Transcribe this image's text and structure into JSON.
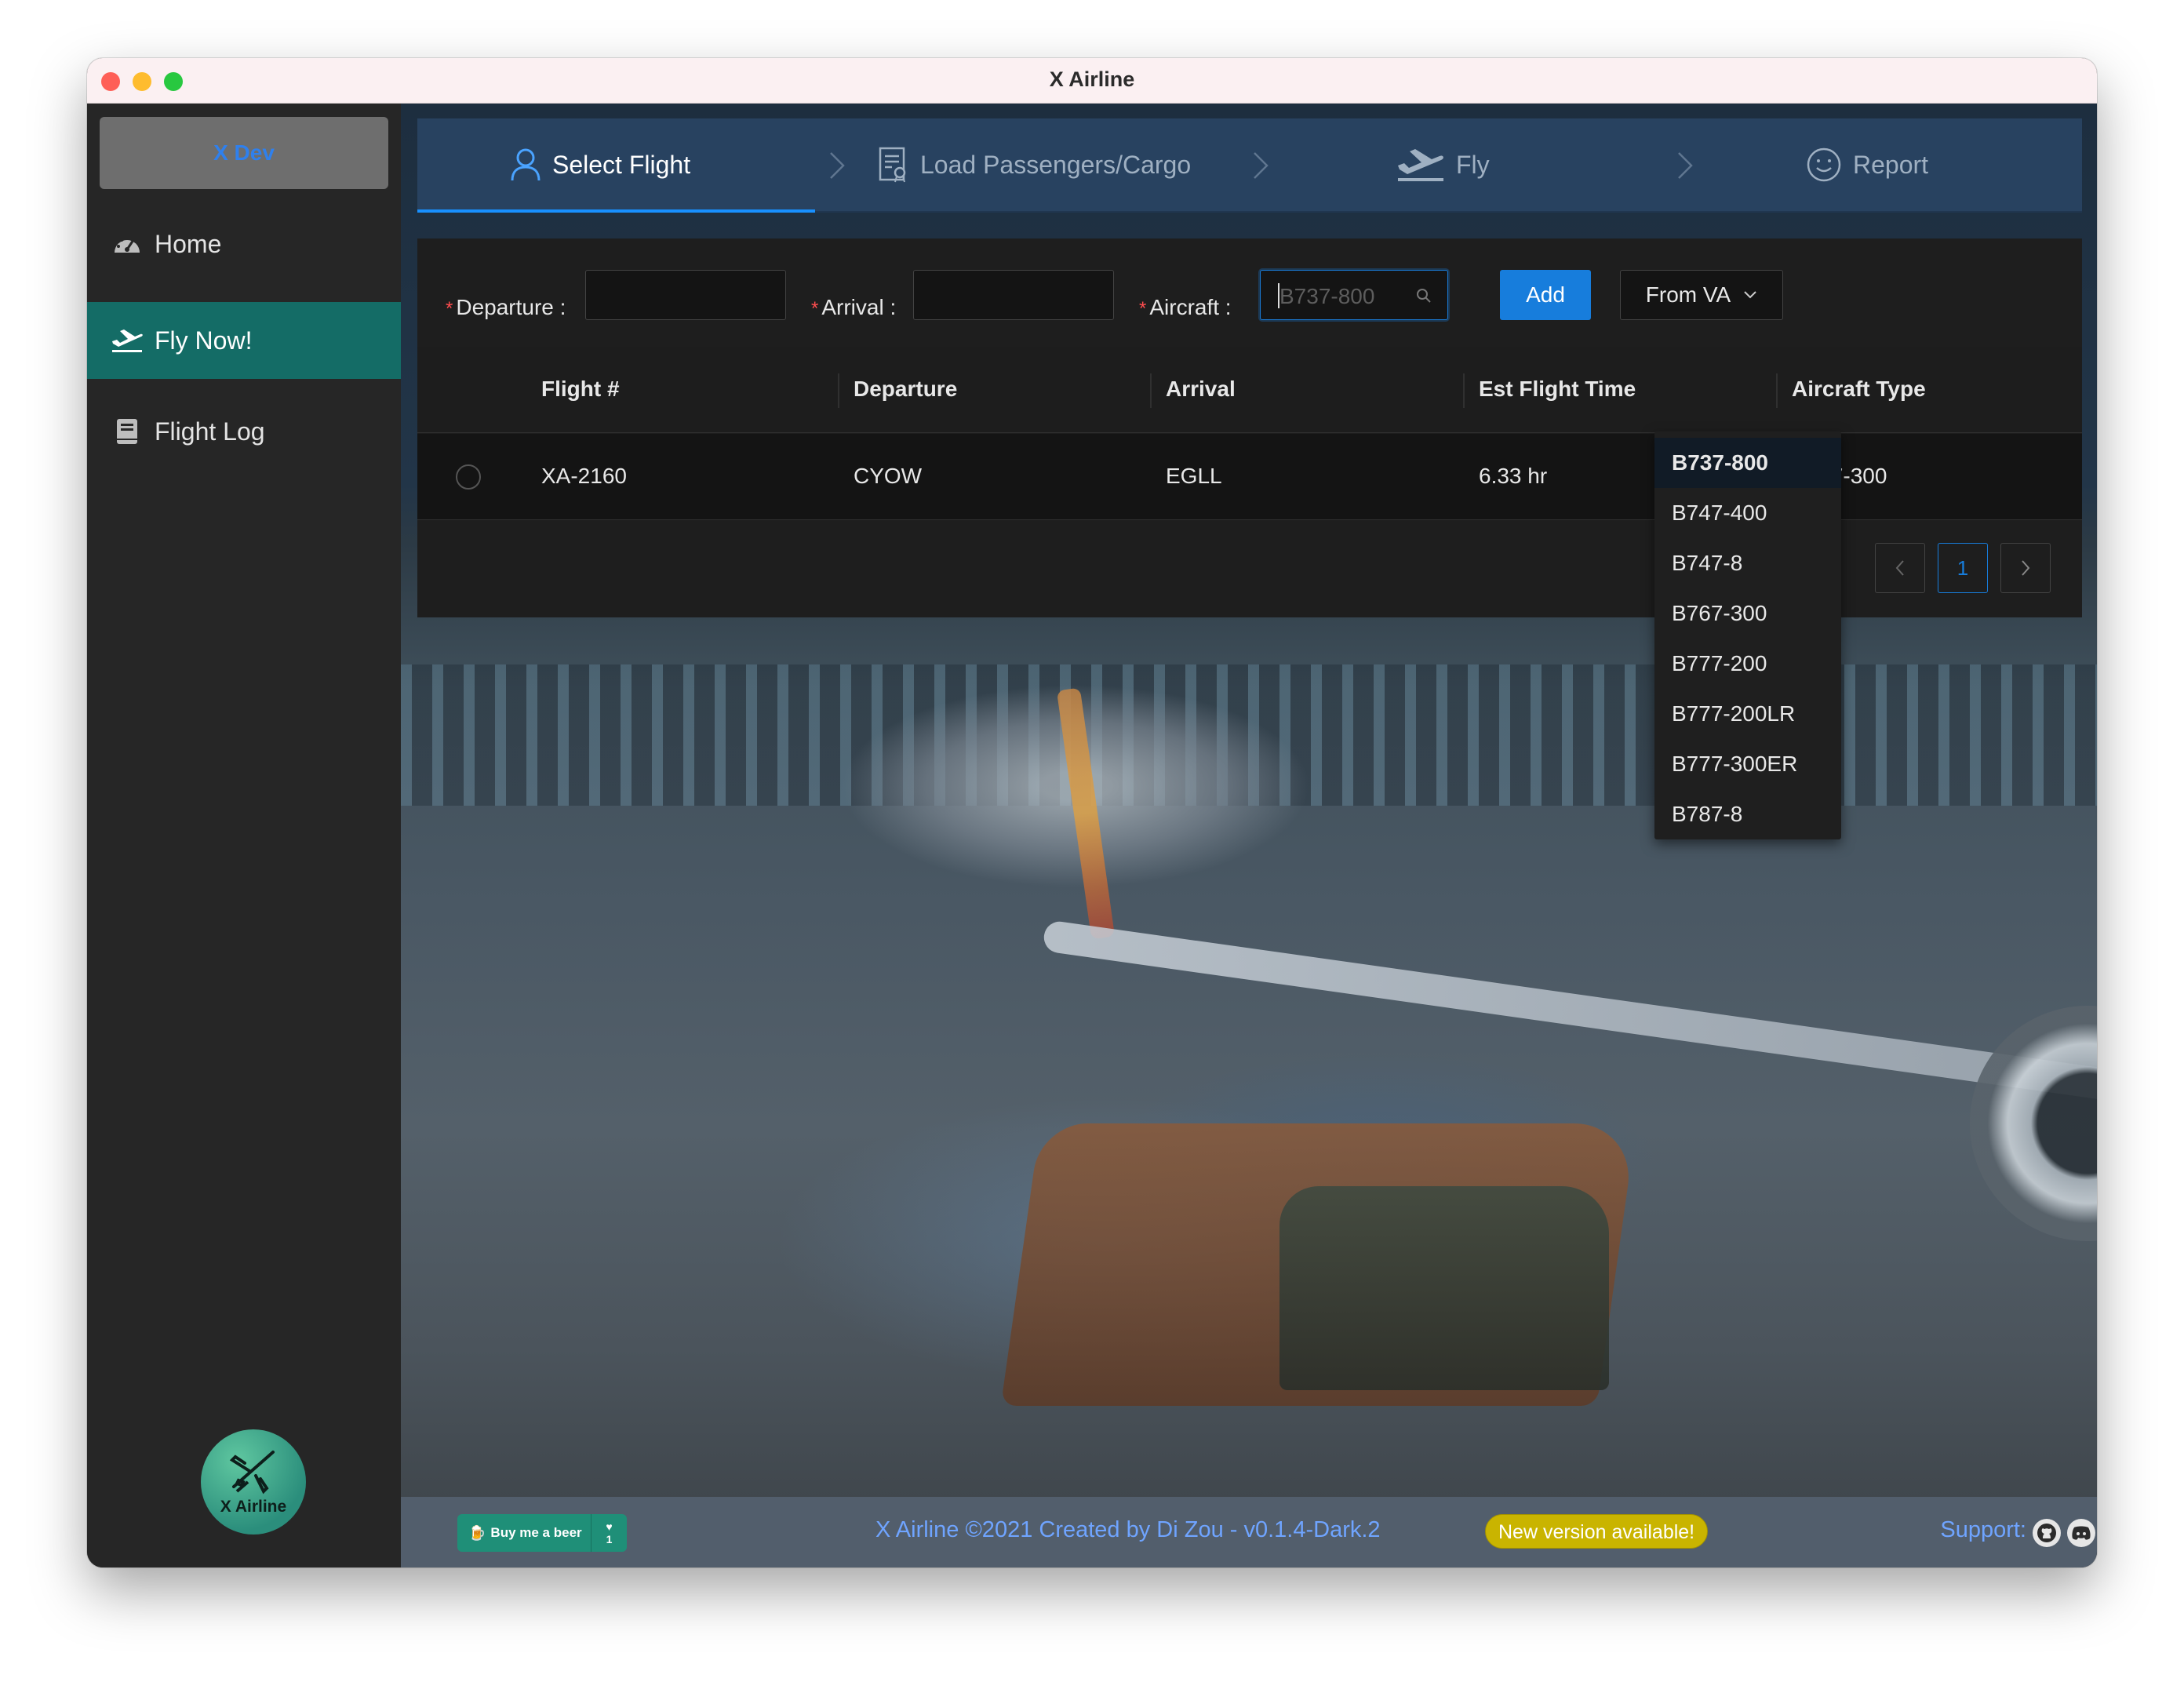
{
  "window": {
    "title": "X Airline"
  },
  "sidebar": {
    "user": "X Dev",
    "items": [
      {
        "label": "Home",
        "icon": "dashboard-icon"
      },
      {
        "label": "Fly Now!",
        "icon": "plane-takeoff-icon",
        "active": true
      },
      {
        "label": "Flight Log",
        "icon": "book-icon"
      }
    ],
    "logo_text": "X Airline"
  },
  "steps": [
    {
      "label": "Select Flight",
      "icon": "user-icon",
      "current": true
    },
    {
      "label": "Load Passengers/Cargo",
      "icon": "document-icon"
    },
    {
      "label": "Fly",
      "icon": "plane-takeoff-icon"
    },
    {
      "label": "Report",
      "icon": "smile-icon"
    }
  ],
  "form": {
    "departure_label": "Departure",
    "arrival_label": "Arrival",
    "aircraft_label": "Aircraft",
    "departure_value": "",
    "arrival_value": "",
    "aircraft_placeholder": "B737-800",
    "add_button": "Add",
    "from_va_button": "From VA"
  },
  "aircraft_options": [
    "B737-800",
    "B747-400",
    "B747-8",
    "B767-300",
    "B777-200",
    "B777-200LR",
    "B777-300ER",
    "B787-8"
  ],
  "aircraft_selected": "B737-800",
  "table": {
    "columns": [
      "Flight #",
      "Departure",
      "Arrival",
      "Est Flight Time",
      "Aircraft Type"
    ],
    "rows": [
      {
        "flight": "XA-2160",
        "departure": "CYOW",
        "arrival": "EGLL",
        "est_time": "6.33 hr",
        "aircraft": "B767-300"
      }
    ]
  },
  "pagination": {
    "current": "1"
  },
  "footer": {
    "beer_label": "Buy me a beer",
    "beer_count": "1",
    "credit": "X Airline ©2021 Created by Di Zou - v0.1.4-Dark.2",
    "new_version": "New version available!",
    "support_label": "Support:"
  },
  "colors": {
    "accent": "#177ddc",
    "active_nav": "#146c66",
    "steps_bg": "#284260",
    "badge": "#c9b400"
  }
}
